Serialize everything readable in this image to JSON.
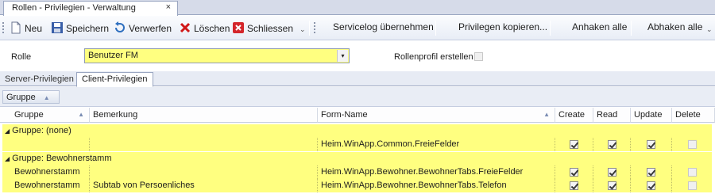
{
  "window": {
    "tab_title": "Rollen - Privilegien - Verwaltung",
    "close_glyph": "×"
  },
  "toolbar": {
    "neu": "Neu",
    "speichern": "Speichern",
    "verwerfen": "Verwerfen",
    "loeschen": "Löschen",
    "schliessen": "Schliessen",
    "servicelog": "Servicelog übernehmen",
    "kopieren": "Privilegen kopieren...",
    "anhaken": "Anhaken alle",
    "abhaken": "Abhaken alle",
    "overflow": "⌄"
  },
  "form": {
    "rolle_label": "Rolle",
    "rolle_value": "Benutzer FM",
    "dropdown_glyph": "▾",
    "profil_label": "Rollenprofil erstellen",
    "profil_checked": false
  },
  "subtabs": [
    "Server-Privilegien",
    "Client-Privilegien"
  ],
  "grouppanel": {
    "chip": "Gruppe",
    "sort_glyph": "▲"
  },
  "grid": {
    "columns": [
      "Gruppe",
      "Bemerkung",
      "Form-Name",
      "Create",
      "Read",
      "Update",
      "Delete"
    ],
    "groups": [
      {
        "header": "Gruppe:  (none)",
        "rows": [
          {
            "gruppe": "",
            "bemerkung": "",
            "form": "Heim.WinApp.Common.FreieFelder",
            "create": true,
            "read": true,
            "update": true,
            "delete": false
          }
        ]
      },
      {
        "header": "Gruppe:  Bewohnerstamm",
        "rows": [
          {
            "gruppe": "Bewohnerstamm",
            "bemerkung": "",
            "form": "Heim.WinApp.Bewohner.BewohnerTabs.FreieFelder",
            "create": true,
            "read": true,
            "update": true,
            "delete": false
          },
          {
            "gruppe": "Bewohnerstamm",
            "bemerkung": "Subtab von Persoenliches",
            "form": "Heim.WinApp.Bewohner.BewohnerTabs.Telefon",
            "create": true,
            "read": true,
            "update": true,
            "delete": false
          }
        ]
      }
    ],
    "expand_glyph": "◢",
    "highlight_color": "#ffff80"
  }
}
